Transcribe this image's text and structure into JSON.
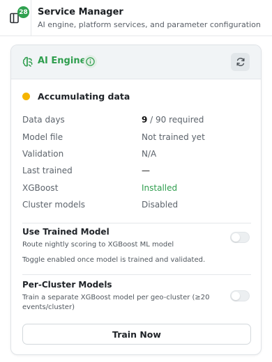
{
  "header": {
    "badge_count": "28",
    "title": "Service Manager",
    "subtitle": "AI engine, platform services, and parameter configuration"
  },
  "card": {
    "title": "AI Engine",
    "status_text": "Accumulating data",
    "status_color": "#f5b400",
    "accent_color": "#2f9e4e",
    "rows": [
      {
        "label": "Data days",
        "value_strong": "9",
        "value": " / 90 required"
      },
      {
        "label": "Model file",
        "value": "Not trained yet"
      },
      {
        "label": "Validation",
        "value": "N/A"
      },
      {
        "label": "Last trained",
        "value": "—"
      },
      {
        "label": "XGBoost",
        "value": "Installed"
      },
      {
        "label": "Cluster models",
        "value": "Disabled"
      }
    ],
    "use_trained": {
      "title": "Use Trained Model",
      "desc": "Route nightly scoring to XGBoost ML model",
      "note": "Toggle enabled once model is trained and validated.",
      "enabled": false
    },
    "per_cluster": {
      "title": "Per-Cluster Models",
      "desc": "Train a separate XGBoost model per geo-cluster (≥20 events/cluster)",
      "enabled": false
    },
    "train_button": "Train Now"
  }
}
